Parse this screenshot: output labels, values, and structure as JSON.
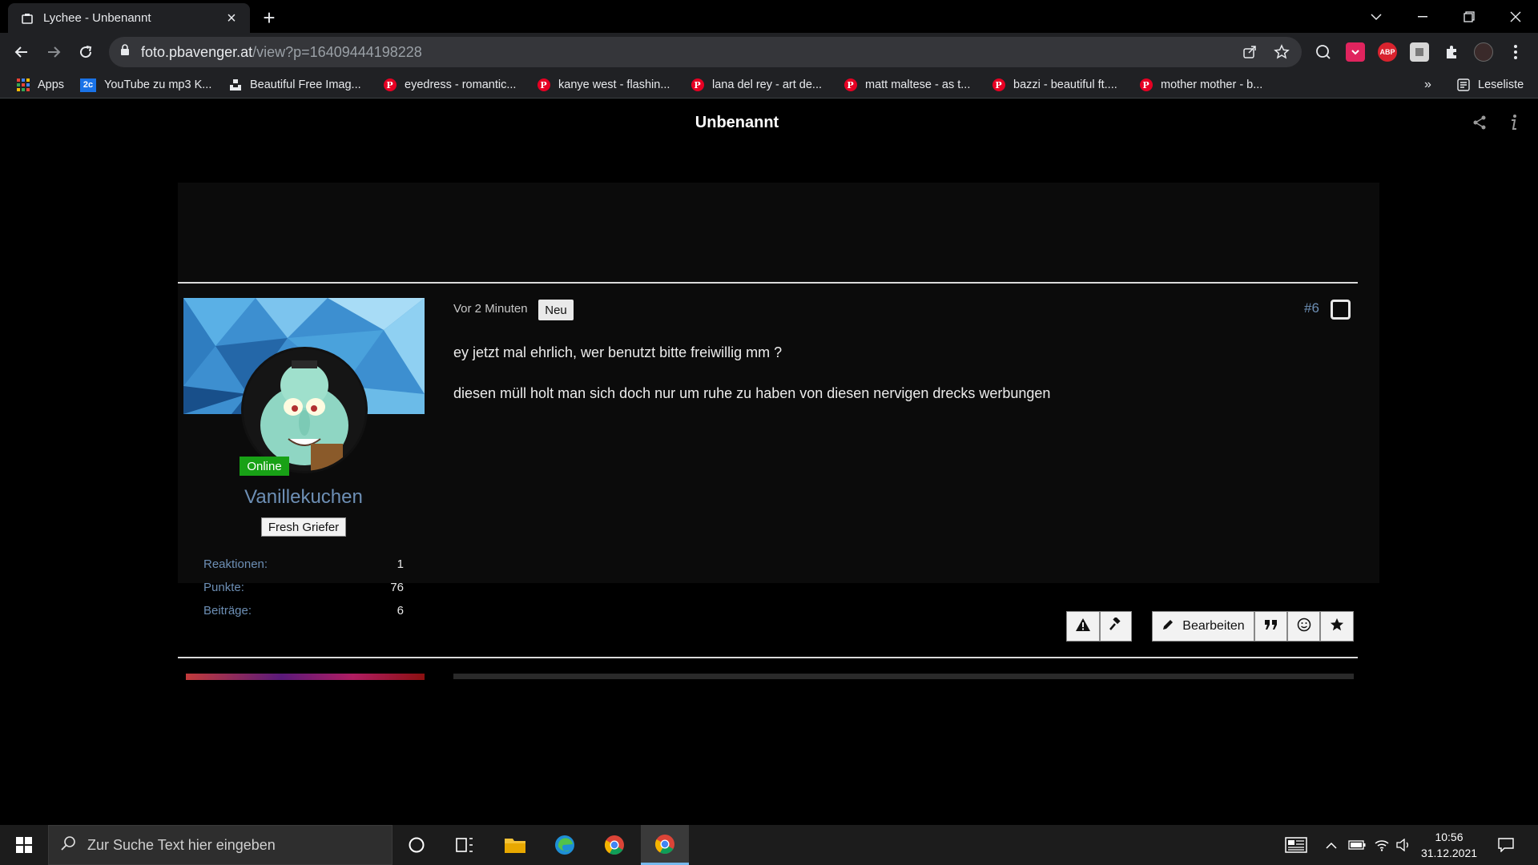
{
  "browser": {
    "tab_title": "Lychee - Unbenannt",
    "url_host": "foto.pbavenger.at",
    "url_path": "/view?p=16409444198228",
    "bookmarks": [
      {
        "label": "Apps",
        "icon": "apps-grid-icon"
      },
      {
        "label": "YouTube zu mp3 K...",
        "icon": "2c-icon"
      },
      {
        "label": "Beautiful Free Imag...",
        "icon": "unsplash-icon"
      },
      {
        "label": "eyedress - romantic...",
        "icon": "pinterest-icon"
      },
      {
        "label": "kanye west - flashin...",
        "icon": "pinterest-icon"
      },
      {
        "label": "lana del rey - art de...",
        "icon": "pinterest-icon"
      },
      {
        "label": "matt maltese - as t...",
        "icon": "pinterest-icon"
      },
      {
        "label": "bazzi - beautiful ft....",
        "icon": "pinterest-icon"
      },
      {
        "label": "mother mother - b...",
        "icon": "pinterest-icon"
      }
    ],
    "bookmarks_overflow": "»",
    "reading_list": "Leseliste",
    "bookmark_icon_2c": "2c",
    "abp_label": "ABP",
    "pinterest_glyph": "P"
  },
  "page": {
    "title": "Unbenannt"
  },
  "post": {
    "time": "Vor 2 Minuten",
    "badge": "Neu",
    "number": "#6",
    "lines": [
      "ey jetzt mal ehrlich, wer benutzt bitte freiwillig mm ?",
      "diesen müll holt man sich doch nur um ruhe zu haben von diesen nervigen drecks werbungen"
    ],
    "user": {
      "status": "Online",
      "name": "Vanillekuchen",
      "title": "Fresh Griefer",
      "stats": [
        {
          "label": "Reaktionen:",
          "value": "1"
        },
        {
          "label": "Punkte:",
          "value": "76"
        },
        {
          "label": "Beiträge:",
          "value": "6"
        }
      ]
    },
    "actions": {
      "edit_label": "Bearbeiten"
    }
  },
  "taskbar": {
    "search_placeholder": "Zur Suche Text hier eingeben",
    "time": "10:56",
    "date": "31.12.2021"
  },
  "colors": {
    "accent_link": "#6d8fb5",
    "online": "#18a116",
    "pinterest": "#e60023"
  }
}
